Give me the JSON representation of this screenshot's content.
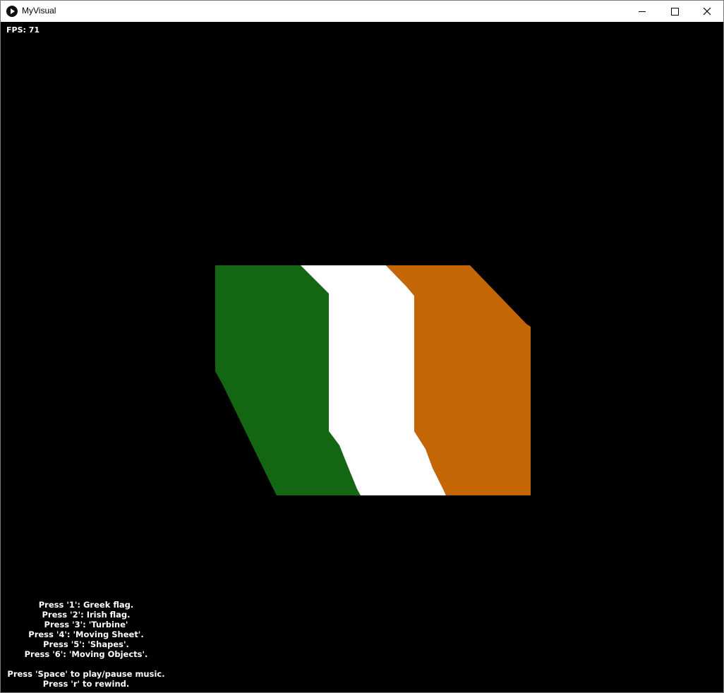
{
  "window": {
    "title": "MyVisual",
    "icon": "play-icon"
  },
  "controls": {
    "minimize": "minimize-icon",
    "maximize": "maximize-icon",
    "close": "close-icon"
  },
  "overlay": {
    "fps": "FPS: 71"
  },
  "flag": {
    "name": "Irish flag",
    "colors": {
      "green": "#136712",
      "white": "#ffffff",
      "orange": "#c56606"
    }
  },
  "help": {
    "lines": [
      "Press '1': Greek flag.",
      "Press '2': Irish flag.",
      "Press '3': 'Turbine'",
      "Press '4': 'Moving Sheet'.",
      "Press '5': 'Shapes'.",
      "Press '6': 'Moving Objects'."
    ],
    "music": "Press 'Space' to play/pause music.",
    "rewind": "Press 'r' to rewind."
  }
}
